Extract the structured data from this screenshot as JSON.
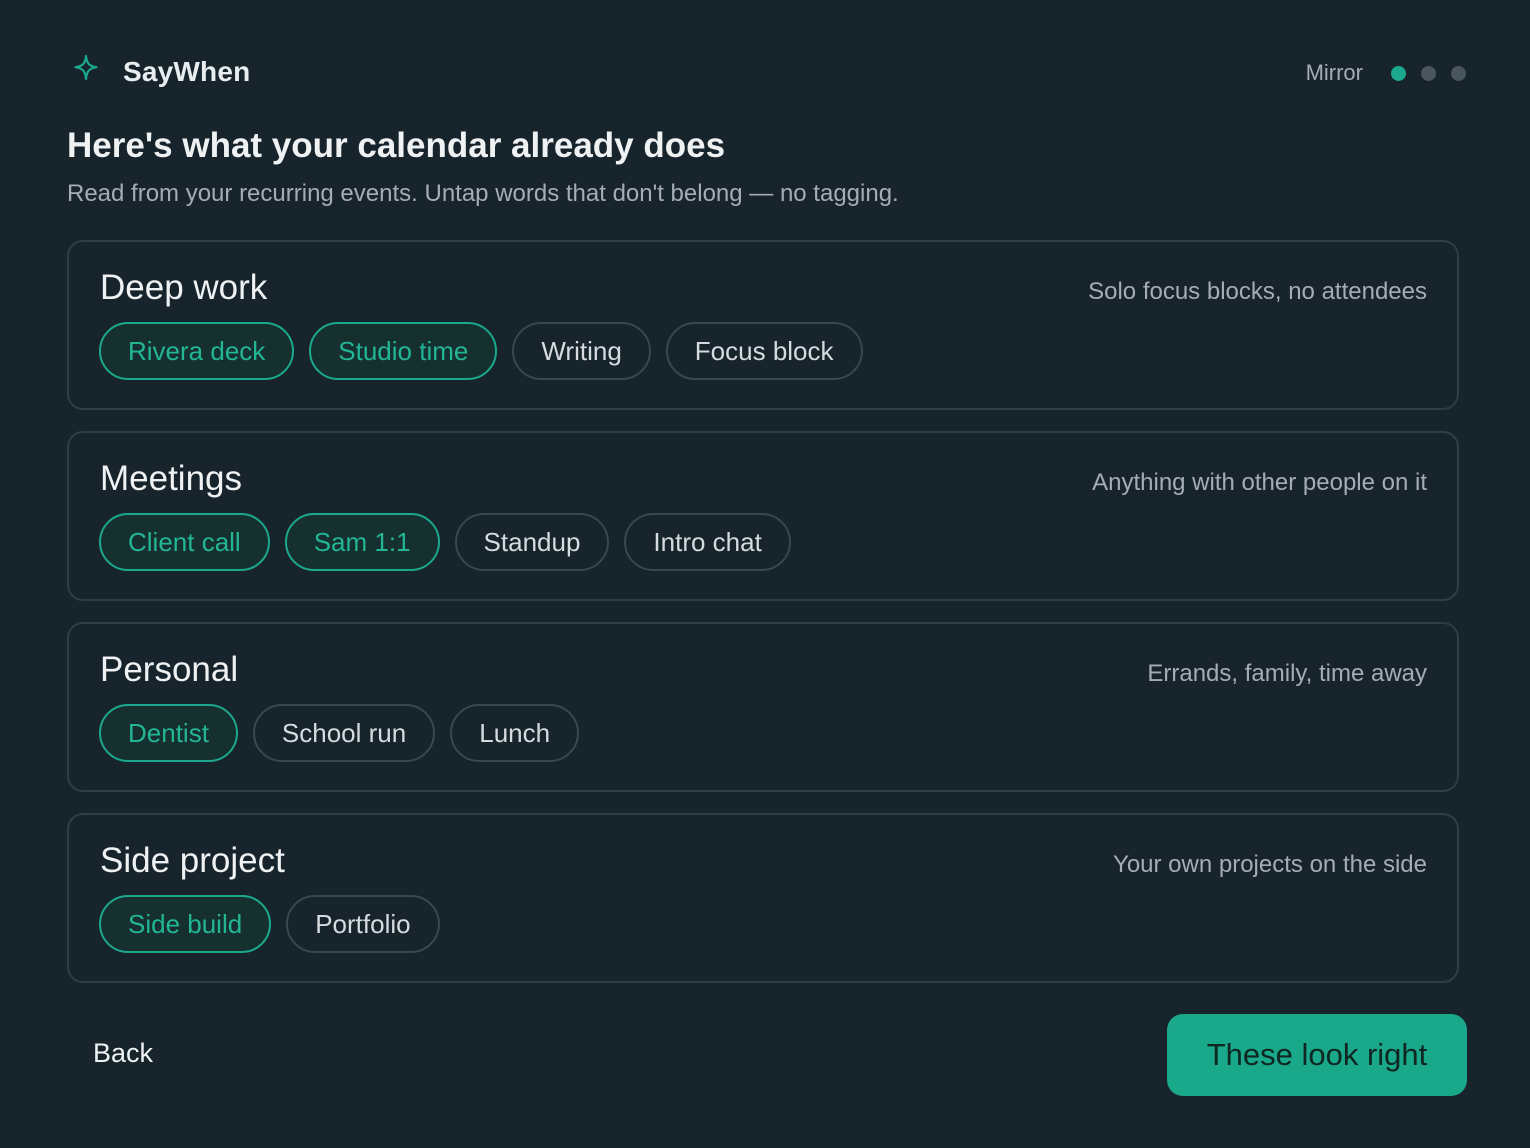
{
  "app": {
    "name": "SayWhen",
    "logo_icon": "sparkle-icon"
  },
  "stepper": {
    "label": "Mirror",
    "total_steps": 3,
    "current_step": 1
  },
  "page": {
    "title": "Here's what your calendar already does",
    "subtitle": "Read from your recurring events. Untap words that don't belong — no tagging."
  },
  "categories": [
    {
      "title": "Deep work",
      "description": "Solo focus blocks, no attendees",
      "chips": [
        {
          "label": "Rivera deck",
          "selected": true
        },
        {
          "label": "Studio time",
          "selected": true
        },
        {
          "label": "Writing",
          "selected": false
        },
        {
          "label": "Focus block",
          "selected": false
        }
      ]
    },
    {
      "title": "Meetings",
      "description": "Anything with other people on it",
      "chips": [
        {
          "label": "Client call",
          "selected": true
        },
        {
          "label": "Sam 1:1",
          "selected": true
        },
        {
          "label": "Standup",
          "selected": false
        },
        {
          "label": "Intro chat",
          "selected": false
        }
      ]
    },
    {
      "title": "Personal",
      "description": "Errands, family, time away",
      "chips": [
        {
          "label": "Dentist",
          "selected": true
        },
        {
          "label": "School run",
          "selected": false
        },
        {
          "label": "Lunch",
          "selected": false
        }
      ]
    },
    {
      "title": "Side project",
      "description": "Your own projects on the side",
      "chips": [
        {
          "label": "Side build",
          "selected": true
        },
        {
          "label": "Portfolio",
          "selected": false
        }
      ]
    }
  ],
  "footer": {
    "back_label": "Back",
    "confirm_label": "These look right"
  },
  "colors": {
    "background": "#18242c",
    "accent": "#1aa88b",
    "card_border": "#2f3d45",
    "muted_text": "#a3adb3"
  }
}
